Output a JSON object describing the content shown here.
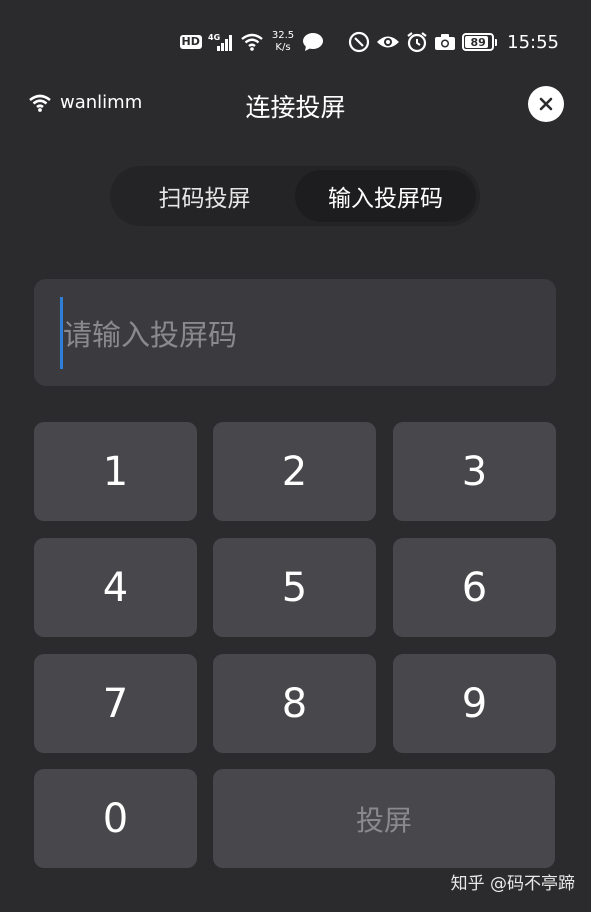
{
  "status_bar": {
    "hd": "HD",
    "signal_label": "4G",
    "net_speed_value": "32.5",
    "net_speed_unit": "K/s",
    "battery": "89",
    "battery_level": 0.89,
    "time": "15:55",
    "icons": [
      "hd-badge",
      "signal-icon",
      "wifi-icon",
      "chat-icon",
      "no-disturb-icon",
      "eye-icon",
      "alarm-icon",
      "camera-icon",
      "battery-icon"
    ]
  },
  "header": {
    "wifi_name": "wanlimm",
    "title": "连接投屏"
  },
  "tabs": [
    {
      "label": "扫码投屏",
      "active": false
    },
    {
      "label": "输入投屏码",
      "active": true
    }
  ],
  "input": {
    "placeholder": "请输入投屏码",
    "caret_color": "#2f7fd9"
  },
  "keypad": {
    "keys": [
      "1",
      "2",
      "3",
      "4",
      "5",
      "6",
      "7",
      "8",
      "9",
      "0"
    ],
    "cast_label": "投屏"
  },
  "watermark": "知乎 @码不亭蹄",
  "colors": {
    "background": "#2b2b2e",
    "key": "#48484c",
    "input": "#3b3b3f",
    "accent": "#2f7fd9"
  }
}
